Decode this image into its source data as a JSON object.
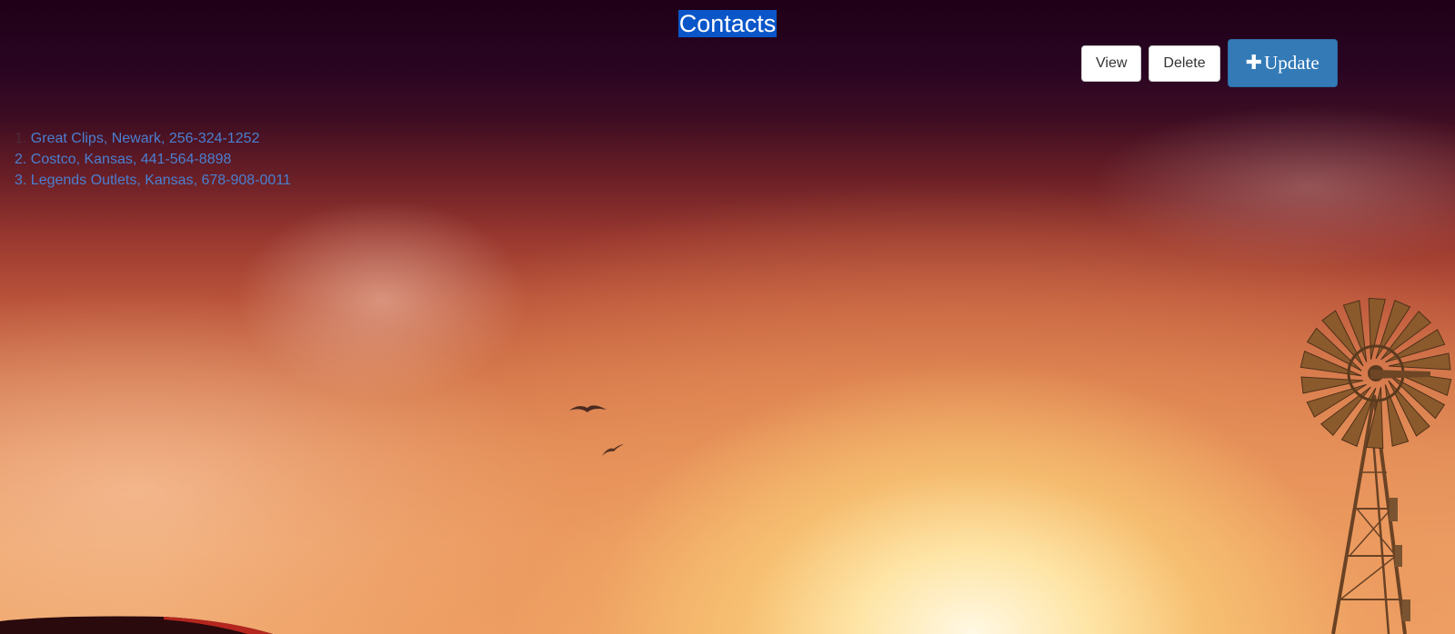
{
  "header": {
    "title": "Contacts"
  },
  "toolbar": {
    "view_label": "View",
    "delete_label": "Delete",
    "update_label": "Update",
    "update_icon": "plus-icon"
  },
  "contacts": [
    {
      "number": "1.",
      "text": "Great Clips, Newark, 256-324-1252"
    },
    {
      "number": "2.",
      "text": "Costco, Kansas, 441-564-8898"
    },
    {
      "number": "3.",
      "text": "Legends Outlets, Kansas, 678-908-0011"
    }
  ],
  "colors": {
    "title_highlight": "#0a56c9",
    "primary_button": "#337ab7",
    "link_text": "#4a7fd0"
  }
}
